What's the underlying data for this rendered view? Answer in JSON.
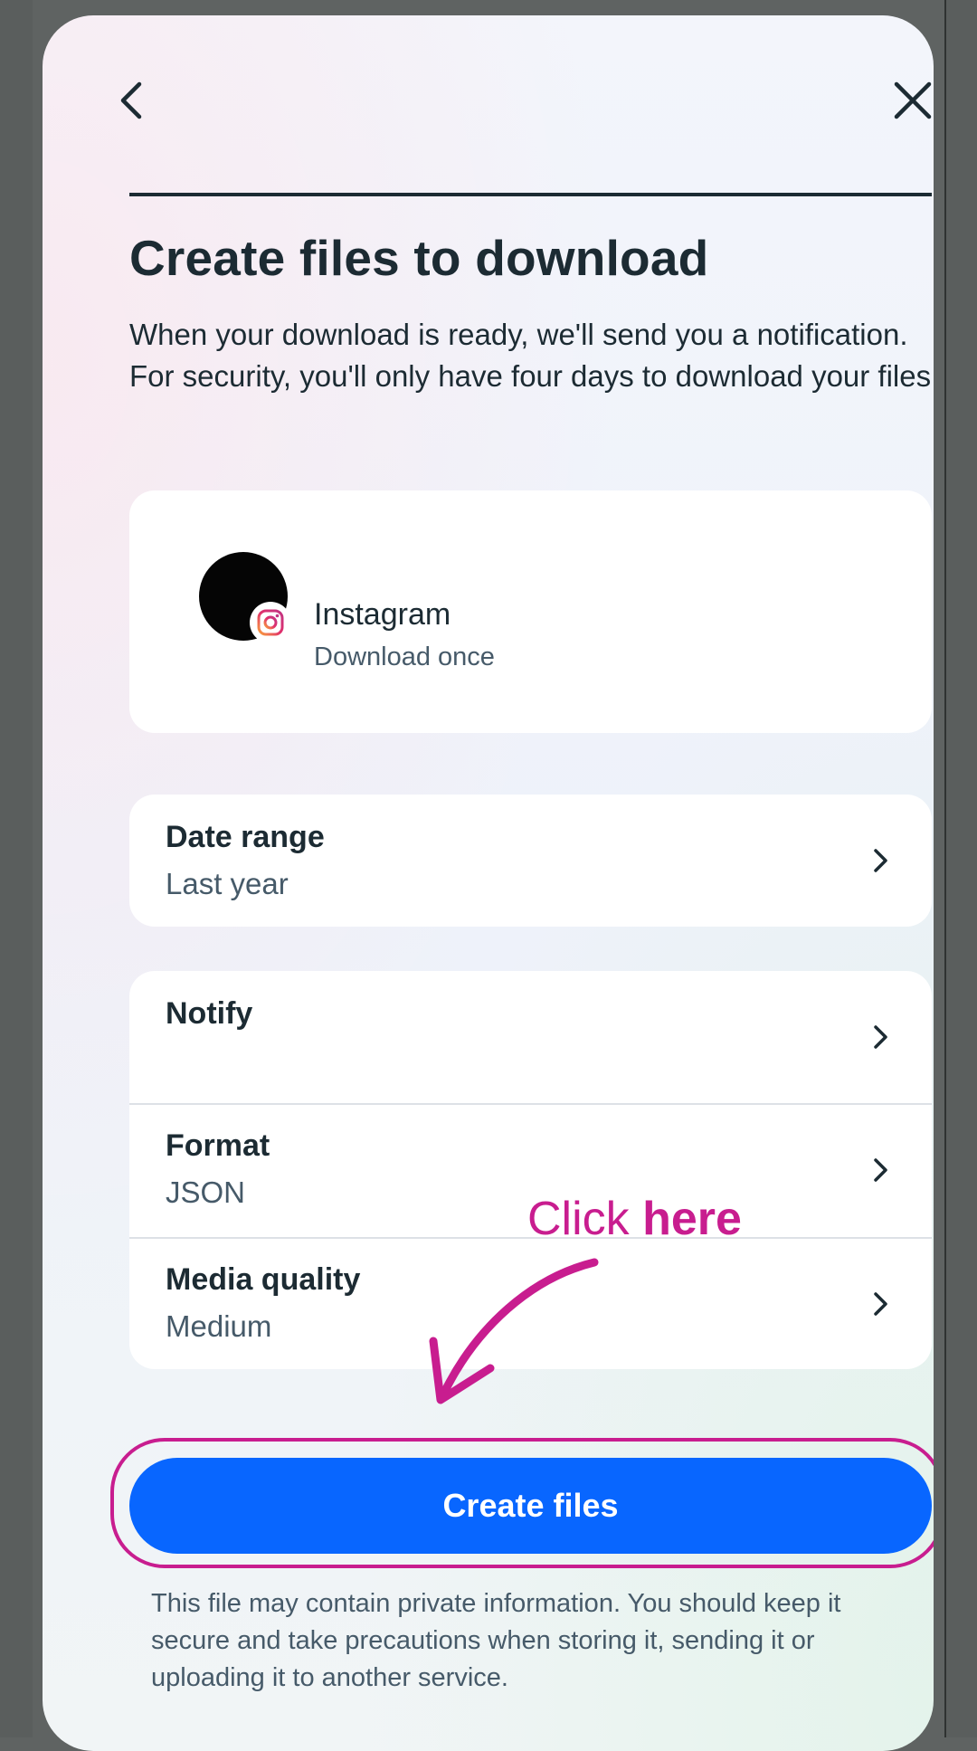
{
  "header": {
    "back_icon": "chevron-left-icon",
    "close_icon": "close-icon"
  },
  "page": {
    "title": "Create files to download",
    "description": "When your download is ready, we'll send you a notification. For security, you'll only have four days to download your files."
  },
  "account": {
    "name": "Instagram",
    "subtitle": "Download once",
    "badge_icon": "instagram-icon"
  },
  "options": {
    "date_range": {
      "label": "Date range",
      "value": "Last year"
    },
    "notify": {
      "label": "Notify",
      "value": ""
    },
    "format": {
      "label": "Format",
      "value": "JSON"
    },
    "media_quality": {
      "label": "Media quality",
      "value": "Medium"
    }
  },
  "annotation": {
    "prefix": "Click ",
    "emphasis": "here",
    "color": "#c81d8f"
  },
  "actions": {
    "create_files_label": "Create files"
  },
  "footer": {
    "disclaimer": "This file may contain private information. You should keep it secure and take precautions when storing it, sending it or uploading it to another service."
  },
  "colors": {
    "primary": "#0866ff",
    "text": "#1c2b33",
    "secondary_text": "#465a69",
    "annotation": "#c81d8f"
  }
}
